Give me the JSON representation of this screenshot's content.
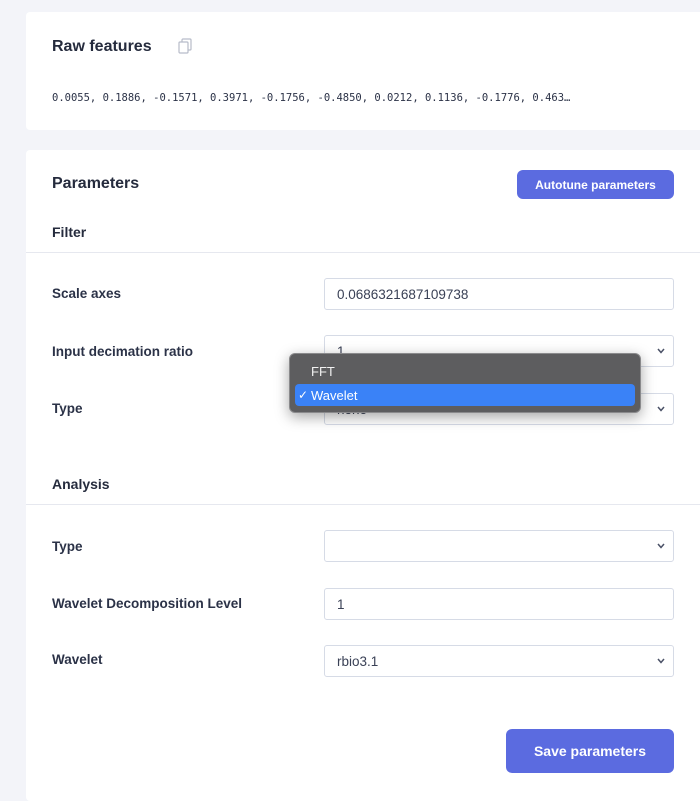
{
  "raw_features": {
    "title": "Raw features",
    "values": "0.0055, 0.1886, -0.1571, 0.3971, -0.1756, -0.4850, 0.0212, 0.1136, -0.1776, 0.463…"
  },
  "parameters": {
    "title": "Parameters",
    "autotune_label": "Autotune parameters",
    "filter": {
      "section_title": "Filter",
      "scale_axes_label": "Scale axes",
      "scale_axes_value": "0.0686321687109738",
      "decimation_label": "Input decimation ratio",
      "decimation_value": "1",
      "type_label": "Type",
      "type_value": "none"
    },
    "analysis": {
      "section_title": "Analysis",
      "type_label": "Type",
      "type_options": [
        {
          "label": "FFT",
          "check": ""
        },
        {
          "label": "Wavelet",
          "check": "✓"
        }
      ],
      "level_label": "Wavelet Decomposition Level",
      "level_value": "1",
      "wavelet_label": "Wavelet",
      "wavelet_value": "rbio3.1"
    },
    "save_label": "Save parameters"
  },
  "colors": {
    "accent": "#5b6be0",
    "dropdown_bg": "#5d5d5f",
    "selection": "#3a82f7"
  },
  "icons": {
    "copy": "copy-icon",
    "chevron": "chevron-down-icon",
    "check": "checkmark-icon"
  }
}
